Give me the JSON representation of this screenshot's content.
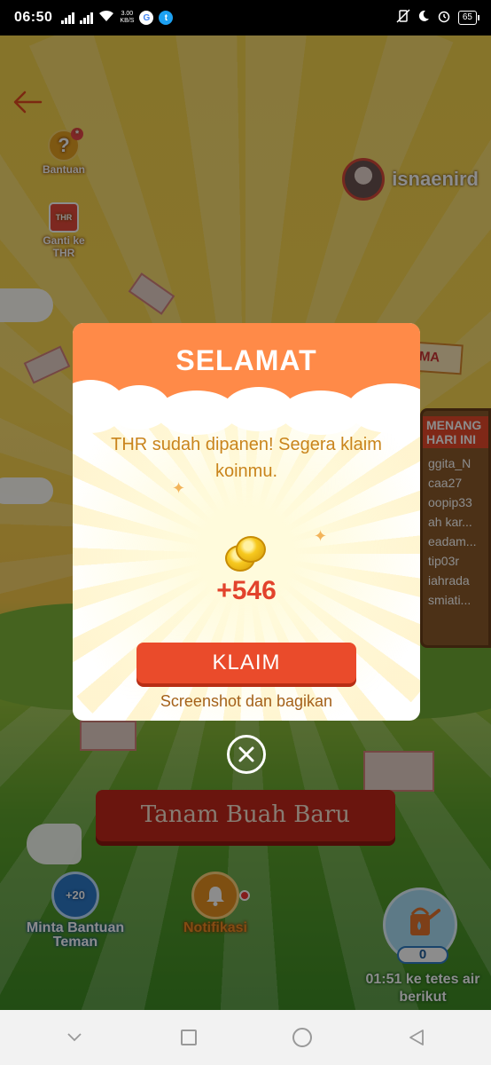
{
  "status_bar": {
    "time": "06:50",
    "net_speed_value": "3.00",
    "net_speed_unit": "KB/S",
    "battery": "65"
  },
  "game": {
    "help_label": "Bantuan",
    "thr_icon_text": "THR",
    "switch_thr_label": "Ganti ke THR",
    "username": "isnaenird",
    "banner_text": "SALING SIRAM, PANEN BERSAMA",
    "board_title": "MENANG HARI INI",
    "board_rows": [
      "ggita_N",
      "caa27",
      "oopip33",
      "ah kar...",
      "eadam...",
      "tip03r",
      "iahrada",
      "smiati..."
    ],
    "plant_button": "Tanam Buah Baru",
    "ask_help_badge": "+20",
    "ask_help_label": "Minta Bantuan Teman",
    "notification_label": "Notifikasi",
    "water_count": "0",
    "water_timer": "01:51 ke tetes air berikut"
  },
  "modal": {
    "title": "SELAMAT",
    "message": "THR sudah dipanen! Segera klaim koinmu.",
    "reward": "+546",
    "claim_button": "KLAIM",
    "share_link": "Screenshot dan bagikan"
  },
  "colors": {
    "header_orange": "#ff8a48",
    "claim_red": "#ea4b2b",
    "reward_red": "#e2432c",
    "message_gold": "#c9841c"
  },
  "icons": [
    "back-arrow-icon",
    "help-icon",
    "thr-icon",
    "coin-icon",
    "close-icon",
    "bell-icon",
    "water-drop-icon",
    "watering-can-icon"
  ]
}
